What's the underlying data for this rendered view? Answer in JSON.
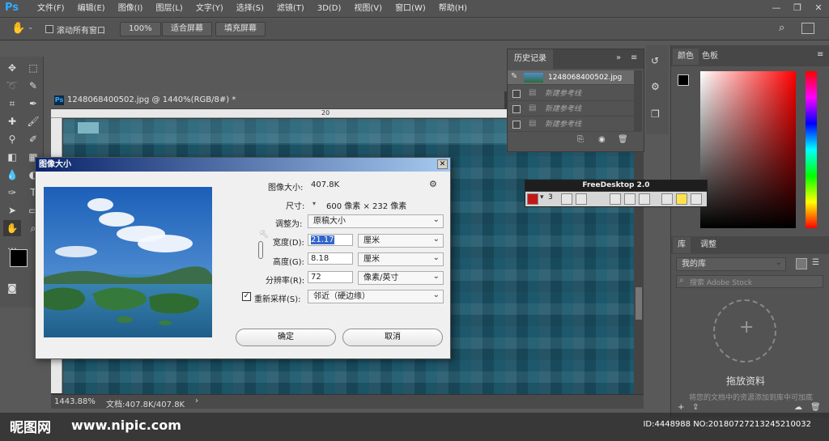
{
  "app": {
    "logo": "Ps"
  },
  "menu": [
    "文件(F)",
    "编辑(E)",
    "图像(I)",
    "图层(L)",
    "文字(Y)",
    "选择(S)",
    "滤镜(T)",
    "3D(D)",
    "视图(V)",
    "窗口(W)",
    "帮助(H)"
  ],
  "window_controls": {
    "minimize": "—",
    "restore": "❐",
    "close": "✕"
  },
  "options_bar": {
    "scroll_all": "滚动所有窗口",
    "zoom_100": "100%",
    "fit_screen": "适合屏幕",
    "fill_screen": "填充屏幕"
  },
  "document": {
    "title": "1248068400502.jpg @ 1440%(RGB/8#) *",
    "ruler_mark": "20",
    "zoom": "1443.88%",
    "doc_size": "文档:407.8K/407.8K"
  },
  "history": {
    "tab": "历史记录",
    "snapshot": "1248068400502.jpg",
    "items": [
      "新建参考线",
      "新建参考线",
      "新建参考线"
    ]
  },
  "right_panels": {
    "color_tab": "颜色",
    "swatches_tab": "色板",
    "library_tab": "库",
    "adjust_tab": "调整",
    "my_library": "我的库",
    "search_placeholder": "搜索 Adobe Stock",
    "drop_title": "拖放资料",
    "drop_hint": "将您的文档中的资源添加到库中可加底"
  },
  "freedesktop": {
    "title": "FreeDesktop 2.0",
    "number": "3"
  },
  "dialog": {
    "title": "图像大小",
    "close": "✕",
    "image_size_label": "图像大小:",
    "image_size_value": "407.8K",
    "dimensions_label": "尺寸:",
    "dimensions_value": "600 像素 × 232 像素",
    "fit_label": "调整为:",
    "fit_value": "原稿大小",
    "width_label": "宽度(D):",
    "width_value": "21.17",
    "width_unit": "厘米",
    "height_label": "高度(G):",
    "height_value": "8.18",
    "height_unit": "厘米",
    "res_label": "分辨率(R):",
    "res_value": "72",
    "res_unit": "像素/英寸",
    "resample_label": "重新采样(S):",
    "resample_value": "邻近（硬边缘）",
    "ok": "确定",
    "cancel": "取消"
  },
  "watermark": {
    "brand": "昵图网",
    "url": "www.nipic.com",
    "id": "ID:4448988 NO:20180727213245210032"
  }
}
